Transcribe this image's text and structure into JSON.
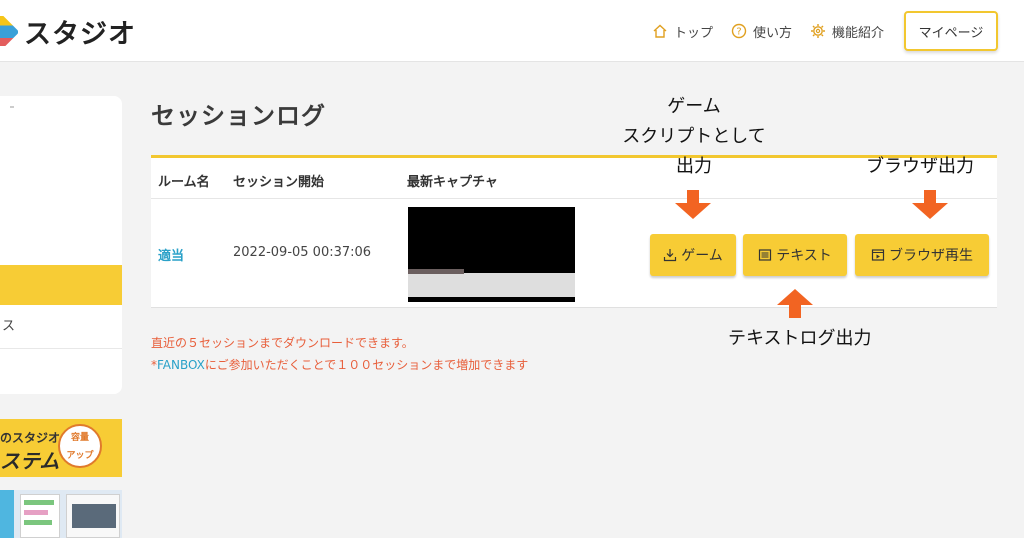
{
  "header": {
    "logo_text": "スタジオ",
    "nav": [
      {
        "icon": "home-icon",
        "label": "トップ"
      },
      {
        "icon": "help-icon",
        "label": "使い方"
      },
      {
        "icon": "gear-icon",
        "label": "機能紹介"
      }
    ],
    "mypage_label": "マイページ"
  },
  "sidebar": {
    "item_label": "ス",
    "banner": {
      "top_text": "のスタジオ",
      "big_text": "ステム",
      "badge_line1": "容量",
      "badge_line2": "アップ"
    }
  },
  "main": {
    "title": "セッションログ",
    "table": {
      "headers": [
        "ルーム名",
        "セッション開始",
        "最新キャプチャ"
      ],
      "rows": [
        {
          "room": "適当",
          "session_start": "2022-09-05 00:37:06"
        }
      ],
      "buttons": {
        "game": "ゲーム",
        "text": "テキスト",
        "browser": "ブラウザ再生"
      }
    },
    "notice_line1": "直近の５セッションまでダウンロードできます。",
    "notice_line2_prefix": "*",
    "notice_line2_fanbox": "FANBOX",
    "notice_line2_rest": "にご参加いただくことで１００セッションまで増加できます"
  },
  "annotations": {
    "game_line1": "ゲーム",
    "game_line2": "スクリプトとして",
    "game_line3": "出力",
    "browser": "ブラウザ出力",
    "text": "テキストログ出力"
  },
  "colors": {
    "accent": "#f7cc35",
    "link": "#2aa1c8",
    "notice": "#e85e3a",
    "arrow": "#f26422"
  }
}
